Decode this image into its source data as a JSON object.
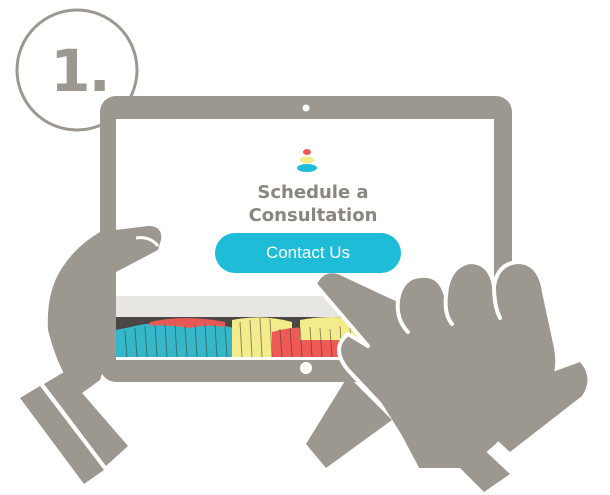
{
  "step": {
    "number_label": "1."
  },
  "screen": {
    "title_line1": "Schedule a",
    "title_line2": "Consultation",
    "cta_label": "Contact Us"
  },
  "icons": {
    "logo": "stacked-stones-logo-icon",
    "camera": "camera-icon",
    "home_button": "home-button-icon",
    "left_hand": "left-hand-icon",
    "right_hand": "pointing-hand-icon"
  },
  "colors": {
    "outline": "#9c9890",
    "accent": "#1ebcd6",
    "coral": "#ef5a55",
    "yellow": "#f4ec8a",
    "text_gray": "#8a867f"
  }
}
